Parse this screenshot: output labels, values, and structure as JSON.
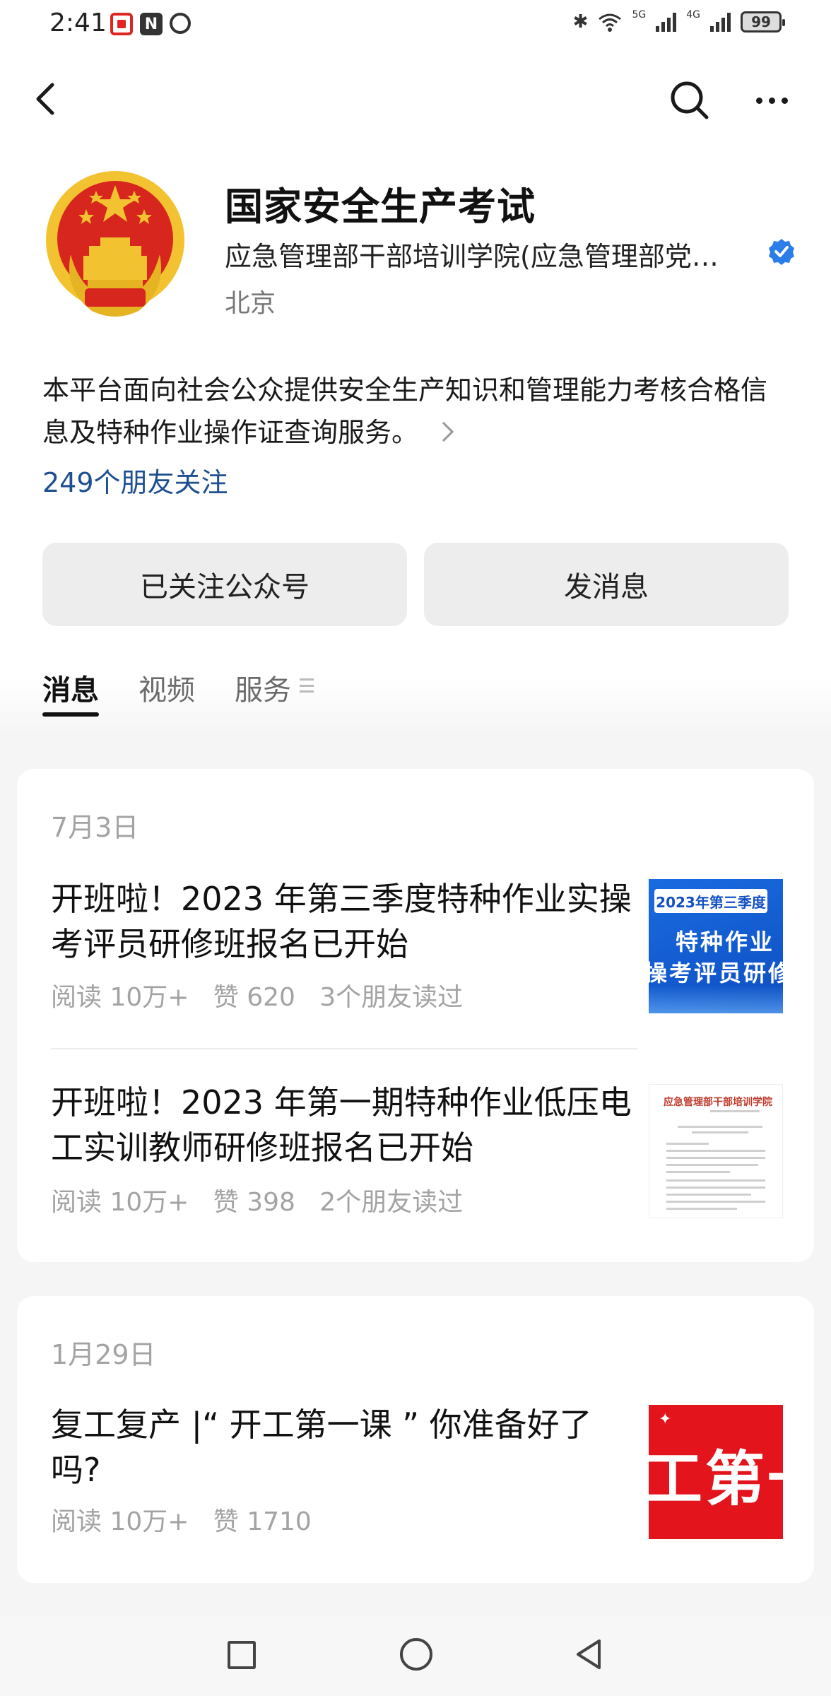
{
  "status_bar": {
    "time": "2:41",
    "net_5g": "5G",
    "net_4g": "4G",
    "battery": "99"
  },
  "account": {
    "name": "国家安全生产考试",
    "org": "应急管理部干部培训学院(应急管理部党…",
    "location": "北京",
    "description": "本平台面向社会公众提供安全生产知识和管理能力考核合格信息及特种作业操作证查询服务。",
    "followers": "249个朋友关注"
  },
  "buttons": {
    "follow": "已关注公众号",
    "message": "发消息"
  },
  "tabs": [
    {
      "label": "消息",
      "active": true
    },
    {
      "label": "视频",
      "active": false
    },
    {
      "label": "服务",
      "active": false
    }
  ],
  "groups": [
    {
      "date": "7月3日",
      "articles": [
        {
          "title": "开班啦！2023 年第三季度特种作业实操考评员研修班报名已开始",
          "meta": "阅读 10万+   赞 620   3个朋友读过",
          "thumb_top": "2023年第三季度",
          "thumb_line1": "特种作业",
          "thumb_line2": "操考评员研修"
        },
        {
          "title": "开班啦！2023 年第一期特种作业低压电工实训教师研修班报名已开始",
          "meta": "阅读 10万+   赞 398   2个朋友读过",
          "thumb_head": "应急管理部干部培训学院"
        }
      ]
    },
    {
      "date": "1月29日",
      "articles": [
        {
          "title": "复工复产 |“ 开工第一课 ” 你准备好了吗?",
          "meta": "阅读 10万+   赞 1710",
          "thumb_text": "工第一"
        }
      ]
    }
  ],
  "colors": {
    "link_blue": "#1d4f91",
    "verified_blue": "#2b7de9",
    "emblem_red": "#d7261e",
    "emblem_gold": "#f2c230"
  }
}
